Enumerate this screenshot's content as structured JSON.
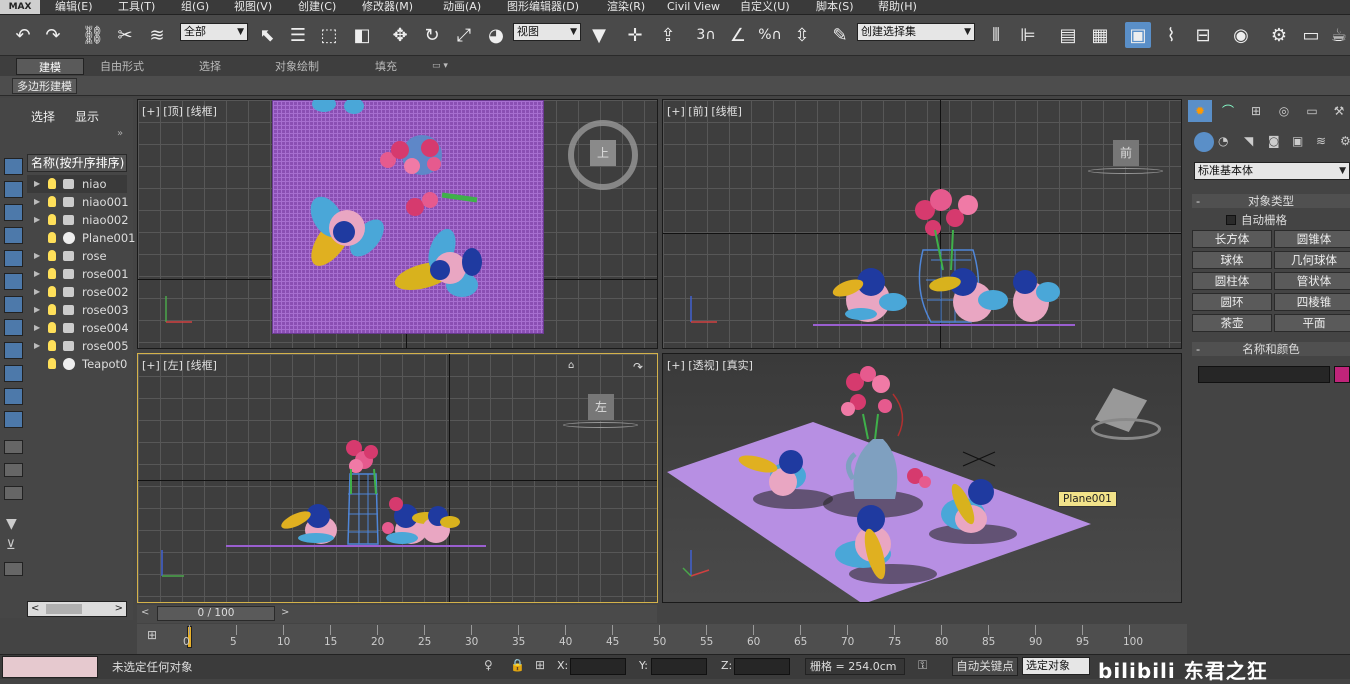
{
  "menu": {
    "logo": "MAX",
    "items": [
      "编辑(E)",
      "工具(T)",
      "组(G)",
      "视图(V)",
      "创建(C)",
      "修改器(M)",
      "动画(A)",
      "图形编辑器(D)",
      "渲染(R)",
      "Civil View",
      "自定义(U)",
      "脚本(S)",
      "帮助(H)"
    ]
  },
  "toolbar": {
    "selection_filter": "全部",
    "ref_coord": "视图",
    "named_selection": "创建选择集",
    "snap_labels": [
      "3",
      "%"
    ]
  },
  "ribbon": {
    "tabs": [
      "建模",
      "自由形式",
      "选择",
      "对象绘制",
      "填充"
    ],
    "sub_label": "多边形建模"
  },
  "scene_explorer": {
    "tabs": [
      "选择",
      "显示"
    ],
    "header": "名称(按升序排序)",
    "items": [
      {
        "name": "niao",
        "type": "group"
      },
      {
        "name": "niao001",
        "type": "group"
      },
      {
        "name": "niao002",
        "type": "group"
      },
      {
        "name": "Plane001",
        "type": "sphere"
      },
      {
        "name": "rose",
        "type": "group"
      },
      {
        "name": "rose001",
        "type": "group"
      },
      {
        "name": "rose002",
        "type": "group"
      },
      {
        "name": "rose003",
        "type": "group"
      },
      {
        "name": "rose004",
        "type": "group"
      },
      {
        "name": "rose005",
        "type": "group"
      },
      {
        "name": "Teapot0",
        "type": "sphere"
      }
    ]
  },
  "viewports": {
    "top": {
      "label": "[+] [顶] [线框]",
      "cube": "上"
    },
    "front": {
      "label": "[+] [前] [线框]",
      "cube": "前"
    },
    "left": {
      "label": "[+] [左] [线框]",
      "cube": "左"
    },
    "persp": {
      "label": "[+] [透视] [真实]",
      "tooltip": "Plane001"
    }
  },
  "command_panel": {
    "category": "标准基本体",
    "rollout_object_type": "对象类型",
    "autogrid": "自动栅格",
    "buttons": [
      "长方体",
      "圆锥体",
      "球体",
      "几何球体",
      "圆柱体",
      "管状体",
      "圆环",
      "四棱锥",
      "茶壶",
      "平面"
    ],
    "rollout_name_color": "名称和颜色",
    "color_swatch": "#c0247a"
  },
  "timeline": {
    "frame": "0 / 100",
    "ticks": [
      0,
      5,
      10,
      15,
      20,
      25,
      30,
      35,
      40,
      45,
      50,
      55,
      60,
      65,
      70,
      75,
      80,
      85,
      90,
      95,
      100
    ]
  },
  "status": {
    "message": "未选定任何对象",
    "x_label": "X:",
    "y_label": "Y:",
    "z_label": "Z:",
    "grid": "栅格 = 254.0cm",
    "auto_key": "自动关键点",
    "set_key_dropdown": "选定对象",
    "watermark": "bilibili 东君之狂"
  }
}
